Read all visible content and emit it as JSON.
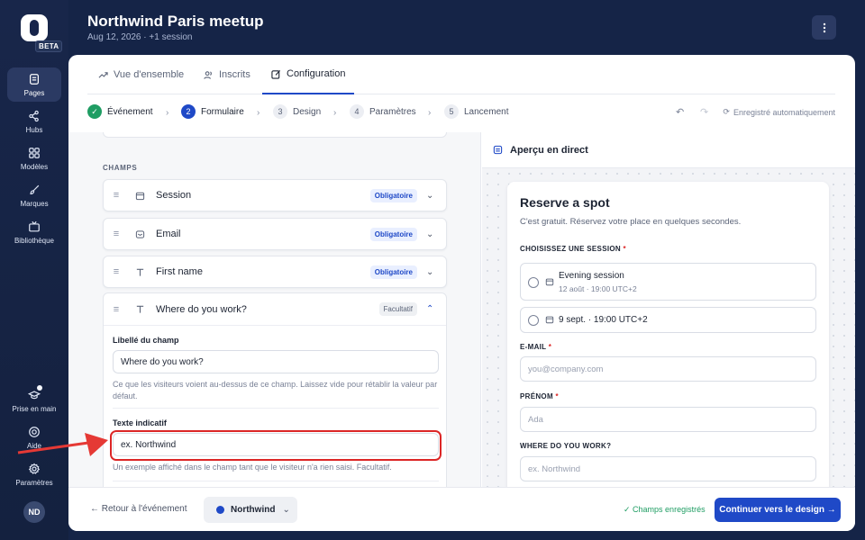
{
  "rail": {
    "beta": "BETA",
    "items": [
      {
        "label": "Pages"
      },
      {
        "label": "Hubs"
      },
      {
        "label": "Modèles"
      },
      {
        "label": "Marques"
      },
      {
        "label": "Bibliothèque"
      },
      {
        "label": "Prise en main"
      },
      {
        "label": "Aide"
      },
      {
        "label": "Paramètres"
      }
    ],
    "avatar": "ND"
  },
  "header": {
    "title": "Northwind Paris meetup",
    "subtitle": "Aug 12, 2026 · +1 session"
  },
  "tabs": [
    {
      "label": "Vue d'ensemble"
    },
    {
      "label": "Inscrits"
    },
    {
      "label": "Configuration"
    }
  ],
  "stepper": {
    "steps": [
      {
        "num": "✓",
        "label": "Événement"
      },
      {
        "num": "2",
        "label": "Formulaire"
      },
      {
        "num": "3",
        "label": "Design"
      },
      {
        "num": "4",
        "label": "Paramètres"
      },
      {
        "num": "5",
        "label": "Lancement"
      }
    ],
    "autosave": "Enregistré automatiquement"
  },
  "fields": {
    "section_label": "CHAMPS",
    "rows": [
      {
        "name": "Session",
        "badge": "Obligatoire"
      },
      {
        "name": "Email",
        "badge": "Obligatoire"
      },
      {
        "name": "First name",
        "badge": "Obligatoire"
      }
    ],
    "expanded": {
      "name": "Where do you work?",
      "badge": "Facultatif",
      "label_title": "Libellé du champ",
      "label_value": "Where do you work?",
      "label_help": "Ce que les visiteurs voient au-dessus de ce champ. Laissez vide pour rétablir la valeur par défaut.",
      "placeholder_title": "Texte indicatif",
      "placeholder_value": "ex. Northwind",
      "placeholder_help": "Un exemple affiché dans le champ tant que le visiteur n'a rien saisi. Facultatif."
    }
  },
  "preview": {
    "title": "Aperçu en direct",
    "form_title": "Reserve a spot",
    "form_sub": "C'est gratuit. Réservez votre place en quelques secondes.",
    "session_label": "CHOISISSEZ UNE SESSION",
    "sessions": [
      {
        "title": "Evening session",
        "sub": "12 août · 19:00 UTC+2"
      },
      {
        "title": "9 sept. · 19:00 UTC+2"
      }
    ],
    "email_label": "E-MAIL",
    "email_placeholder": "you@company.com",
    "firstname_label": "PRÉNOM",
    "firstname_placeholder": "Ada",
    "work_label": "WHERE DO YOU WORK?",
    "work_placeholder": "ex. Northwind",
    "required_mark": "*"
  },
  "footer": {
    "back": "← Retour à l'événement",
    "brand": "Northwind",
    "saved": "✓ Champs enregistrés",
    "cta": "Continuer vers le design →"
  },
  "colors": {
    "accent": "#1f49c7",
    "success": "#1f9d63",
    "highlight": "#dc2626",
    "rail": "#152447"
  }
}
